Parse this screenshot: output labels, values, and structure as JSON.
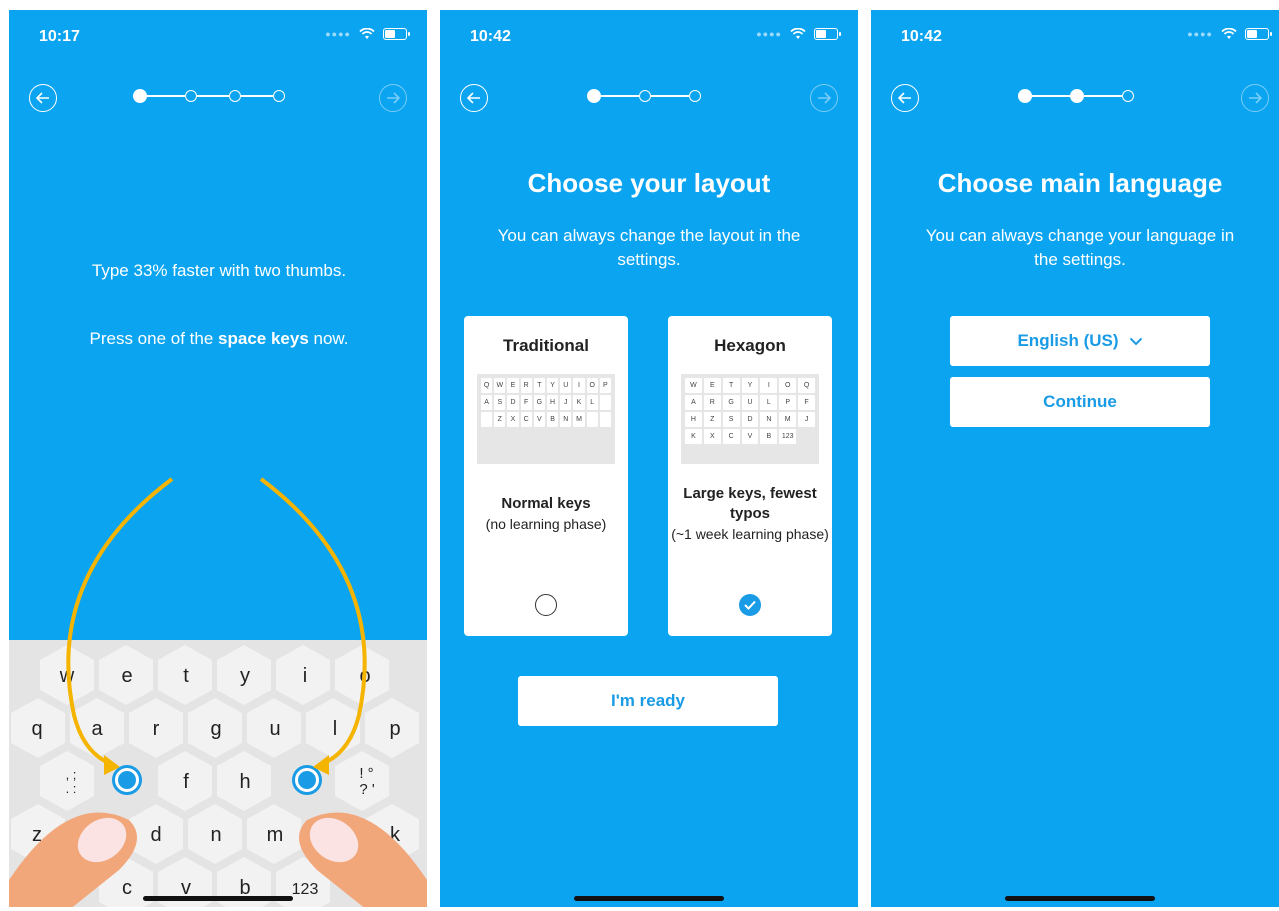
{
  "screens": [
    {
      "time": "10:17",
      "text_line1": "Type 33% faster with two thumbs.",
      "text_line2_pre": "Press one of the ",
      "text_line2_bold": "space keys",
      "text_line2_post": " now.",
      "keys": {
        "row1": [
          "w",
          "e",
          "t",
          "y",
          "i",
          "o"
        ],
        "row2": [
          "q",
          "a",
          "r",
          "g",
          "u",
          "l",
          "p"
        ],
        "row3": [
          "f",
          "h"
        ],
        "row4": [
          "z",
          "d",
          "n",
          "m",
          "k"
        ],
        "row5": [
          "c",
          "v",
          "b",
          "123"
        ],
        "punct_left": ", ;\n. :",
        "punct_right": "! °\n? '"
      }
    },
    {
      "time": "10:42",
      "title": "Choose your layout",
      "subtitle": "You can always change the layout in the settings.",
      "cards": [
        {
          "title": "Traditional",
          "desc_bold": "Normal keys",
          "desc": "(no learning phase)",
          "selected": false,
          "keys": [
            "Q",
            "W",
            "E",
            "R",
            "T",
            "Y",
            "U",
            "I",
            "O",
            "P",
            "A",
            "S",
            "D",
            "F",
            "G",
            "H",
            "J",
            "K",
            "L",
            "",
            "",
            "Z",
            "X",
            "C",
            "V",
            "B",
            "N",
            "M",
            "",
            ""
          ]
        },
        {
          "title": "Hexagon",
          "desc_bold": "Large keys, fewest typos",
          "desc": "(~1 week learning phase)",
          "selected": true,
          "keys": [
            "W",
            "E",
            "T",
            "Y",
            "I",
            "O",
            "Q",
            "A",
            "R",
            "G",
            "U",
            "L",
            "P",
            "F",
            "H",
            "Z",
            "S",
            "D",
            "N",
            "M",
            "J",
            "K",
            "X",
            "C",
            "V",
            "B",
            "123"
          ]
        }
      ],
      "button": "I'm ready"
    },
    {
      "time": "10:42",
      "title": "Choose main language",
      "subtitle": "You can always change your language in the settings.",
      "language": "English (US)",
      "continue": "Continue"
    }
  ],
  "colors": {
    "bg": "#0aa4f0",
    "accent": "#1a9be6",
    "finger": "#f2a77a",
    "arrow": "#f4b400"
  }
}
